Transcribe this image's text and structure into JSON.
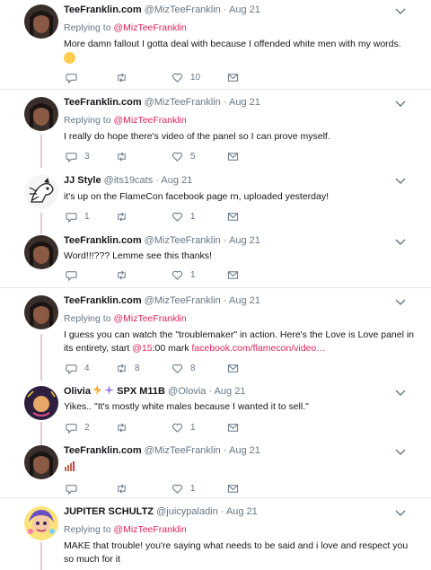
{
  "tweets": [
    {
      "name": "TeeFranklin.com",
      "handle": "@MizTeeFranklin",
      "date": "Aug 21",
      "replying_label": "Replying to",
      "replying_to": "@MizTeeFranklin",
      "text": "More damn fallout I gotta deal with because I offended white men with my words.",
      "reply_count": "",
      "retweet_count": "",
      "like_count": "10"
    },
    {
      "name": "TeeFranklin.com",
      "handle": "@MizTeeFranklin",
      "date": "Aug 21",
      "replying_label": "Replying to",
      "replying_to": "@MizTeeFranklin",
      "text": "I really do hope there's video of the panel so I can prove myself.",
      "reply_count": "3",
      "retweet_count": "",
      "like_count": "5"
    },
    {
      "name": "JJ Style",
      "handle": "@its19cats",
      "date": "Aug 21",
      "text": "it's up on the FlameCon facebook page rn, uploaded yesterday!",
      "reply_count": "1",
      "retweet_count": "",
      "like_count": "1"
    },
    {
      "name": "TeeFranklin.com",
      "handle": "@MizTeeFranklin",
      "date": "Aug 21",
      "text": "Word!!!??? Lemme see this thanks!",
      "reply_count": "",
      "retweet_count": "",
      "like_count": "1"
    },
    {
      "name": "TeeFranklin.com",
      "handle": "@MizTeeFranklin",
      "date": "Aug 21",
      "replying_label": "Replying to",
      "replying_to": "@MizTeeFranklin",
      "text_before": "I guess you can watch the \"troublemaker\" in action. Here's the Love is Love panel in its entirety, start ",
      "text_link1": "@15",
      "text_mid": ":00 mark ",
      "text_link2": "facebook.com/flamecon/video…",
      "reply_count": "4",
      "retweet_count": "8",
      "like_count": "8"
    },
    {
      "name": "Olivia",
      "name_extra": "SPX M11B",
      "handle": "@Olovia",
      "date": "Aug 21",
      "text": "Yikes.. \"It's mostly white males because I wanted it to sell.\"",
      "reply_count": "2",
      "retweet_count": "",
      "like_count": "1"
    },
    {
      "name": "TeeFranklin.com",
      "handle": "@MizTeeFranklin",
      "date": "Aug 21",
      "text": "",
      "reply_count": "",
      "retweet_count": "",
      "like_count": "1"
    },
    {
      "name": "JUPITER SCHULTZ",
      "handle": "@juicypaladin",
      "date": "Aug 21",
      "replying_label": "Replying to",
      "replying_to": "@MizTeeFranklin",
      "text": "MAKE that trouble! you're saying what needs to be said and i love and respect you so much for it"
    }
  ],
  "dot": "·",
  "colors": {
    "mention": "#e0245e",
    "thread_line": "#e6c7d6",
    "muted": "#657786",
    "separator": "#e1e8ed"
  },
  "icons": [
    "reply-icon",
    "retweet-icon",
    "like-icon",
    "message-icon",
    "chevron-down-icon"
  ]
}
